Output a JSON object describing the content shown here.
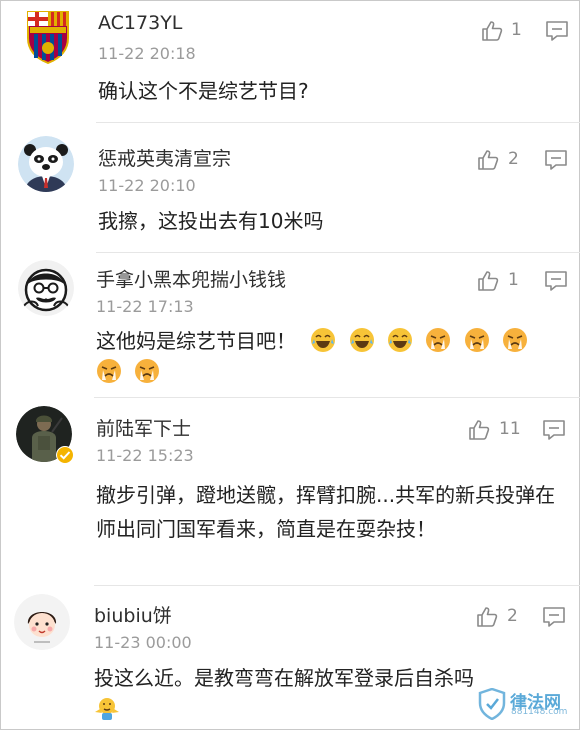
{
  "comments": [
    {
      "username": "AC173YL",
      "time": "11-22 20:18",
      "likes": "1",
      "text": "确认这个不是综艺节目?",
      "avatar_icon": "fc-barcelona-crest-avatar"
    },
    {
      "username": "惩戒英夷清宣宗",
      "time": "11-22 20:10",
      "likes": "2",
      "text": "我擦，这投出去有10米吗",
      "avatar_icon": "panda-in-suit-avatar"
    },
    {
      "username": "手拿小黑本兜揣小钱钱",
      "time": "11-22 17:13",
      "likes": "1",
      "text": "这他妈是综艺节目吧！",
      "emojis": [
        "laugh-cry",
        "laugh-cry",
        "laugh-cry",
        "crying",
        "crying",
        "crying",
        "crying",
        "crying"
      ],
      "avatar_icon": "cartoon-face-avatar"
    },
    {
      "username": "前陆军下士",
      "time": "11-22 15:23",
      "likes": "11",
      "text": "撤步引弹，蹬地送髋，挥臂扣腕...共军的新兵投弹在师出同门国军看来，简直是在耍杂技！",
      "avatar_icon": "soldier-photo-avatar",
      "verified": true
    },
    {
      "username": "biubiu饼",
      "time": "11-23 00:00",
      "likes": "2",
      "text": "投这么近。是教弯弯在解放军登录后自杀吗",
      "emojis": [
        "shrug"
      ],
      "avatar_icon": "cartoon-girl-avatar"
    }
  ],
  "watermark": {
    "title": "律法网",
    "sub": "881148.com"
  },
  "colors": {
    "name": "#2f2f2f",
    "time": "#9b9b9b",
    "body": "#222222",
    "icon": "#8a8a8a",
    "emoji_yellow": "#f7c437",
    "watermark": "#5aa9d8"
  }
}
